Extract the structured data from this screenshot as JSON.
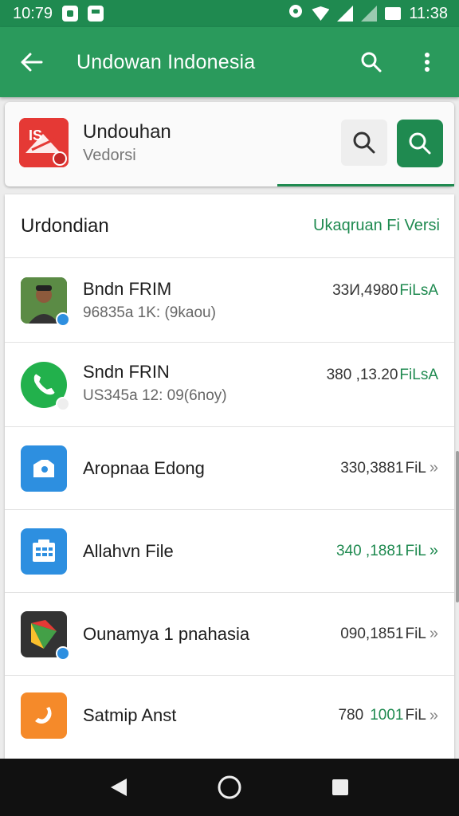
{
  "status_bar": {
    "time_left": "10:79",
    "time_right": "11:38"
  },
  "app_bar": {
    "title": "Undowan Indonesia",
    "back_icon": "arrow-left-icon",
    "search_icon": "search-icon",
    "menu_icon": "more-vert-icon"
  },
  "header_card": {
    "title": "Undouhan",
    "subtitle": "Vedorsi"
  },
  "list": {
    "title": "Urdondian",
    "link": "Ukaqruan Fi Versi",
    "items": [
      {
        "name": "Bndn FRIM",
        "detail": "96835a 1K: (9kaou)",
        "size": "33И,4980",
        "tag": "FiLsA",
        "icon": "profile-photo",
        "color": "#4a7a3a"
      },
      {
        "name": "Sndn FRIN",
        "detail": "US345a 12: 09(6noy)",
        "size": "380 ,13.20",
        "tag": "FiLsA",
        "icon": "phone-icon",
        "color": "#22b14c"
      },
      {
        "name": "Aropnaa Edong",
        "detail": "",
        "size": "330,3881",
        "tag": "FiL",
        "icon": "camera-tag-icon",
        "color": "#2d8fe0"
      },
      {
        "name": "Allahvn File",
        "detail": "",
        "size": "340 ,1881",
        "tag": "FiL",
        "icon": "calendar-grid-icon",
        "color": "#2d8fe0"
      },
      {
        "name": "Ounamya 1 pnahasia",
        "detail": "",
        "size": "090,1851",
        "tag": "FiL",
        "icon": "play-store-icon",
        "color": "#333333"
      },
      {
        "name": "Satmip Anst",
        "detail": "",
        "size": "780",
        "size_green": "1001",
        "tag": "FiL",
        "icon": "swirl-icon",
        "color": "#f58a2a"
      }
    ]
  },
  "colors": {
    "primary": "#2a9a5c",
    "primary_dark": "#1f8a50"
  }
}
